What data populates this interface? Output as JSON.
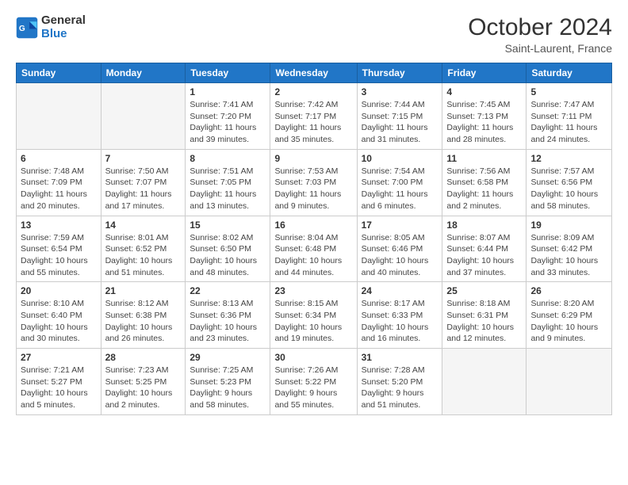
{
  "header": {
    "logo_general": "General",
    "logo_blue": "Blue",
    "month": "October 2024",
    "location": "Saint-Laurent, France"
  },
  "days_of_week": [
    "Sunday",
    "Monday",
    "Tuesday",
    "Wednesday",
    "Thursday",
    "Friday",
    "Saturday"
  ],
  "weeks": [
    [
      {
        "day": "",
        "sunrise": "",
        "sunset": "",
        "daylight": "",
        "empty": true
      },
      {
        "day": "",
        "sunrise": "",
        "sunset": "",
        "daylight": "",
        "empty": true
      },
      {
        "day": "1",
        "sunrise": "Sunrise: 7:41 AM",
        "sunset": "Sunset: 7:20 PM",
        "daylight": "Daylight: 11 hours and 39 minutes."
      },
      {
        "day": "2",
        "sunrise": "Sunrise: 7:42 AM",
        "sunset": "Sunset: 7:17 PM",
        "daylight": "Daylight: 11 hours and 35 minutes."
      },
      {
        "day": "3",
        "sunrise": "Sunrise: 7:44 AM",
        "sunset": "Sunset: 7:15 PM",
        "daylight": "Daylight: 11 hours and 31 minutes."
      },
      {
        "day": "4",
        "sunrise": "Sunrise: 7:45 AM",
        "sunset": "Sunset: 7:13 PM",
        "daylight": "Daylight: 11 hours and 28 minutes."
      },
      {
        "day": "5",
        "sunrise": "Sunrise: 7:47 AM",
        "sunset": "Sunset: 7:11 PM",
        "daylight": "Daylight: 11 hours and 24 minutes."
      }
    ],
    [
      {
        "day": "6",
        "sunrise": "Sunrise: 7:48 AM",
        "sunset": "Sunset: 7:09 PM",
        "daylight": "Daylight: 11 hours and 20 minutes."
      },
      {
        "day": "7",
        "sunrise": "Sunrise: 7:50 AM",
        "sunset": "Sunset: 7:07 PM",
        "daylight": "Daylight: 11 hours and 17 minutes."
      },
      {
        "day": "8",
        "sunrise": "Sunrise: 7:51 AM",
        "sunset": "Sunset: 7:05 PM",
        "daylight": "Daylight: 11 hours and 13 minutes."
      },
      {
        "day": "9",
        "sunrise": "Sunrise: 7:53 AM",
        "sunset": "Sunset: 7:03 PM",
        "daylight": "Daylight: 11 hours and 9 minutes."
      },
      {
        "day": "10",
        "sunrise": "Sunrise: 7:54 AM",
        "sunset": "Sunset: 7:00 PM",
        "daylight": "Daylight: 11 hours and 6 minutes."
      },
      {
        "day": "11",
        "sunrise": "Sunrise: 7:56 AM",
        "sunset": "Sunset: 6:58 PM",
        "daylight": "Daylight: 11 hours and 2 minutes."
      },
      {
        "day": "12",
        "sunrise": "Sunrise: 7:57 AM",
        "sunset": "Sunset: 6:56 PM",
        "daylight": "Daylight: 10 hours and 58 minutes."
      }
    ],
    [
      {
        "day": "13",
        "sunrise": "Sunrise: 7:59 AM",
        "sunset": "Sunset: 6:54 PM",
        "daylight": "Daylight: 10 hours and 55 minutes."
      },
      {
        "day": "14",
        "sunrise": "Sunrise: 8:01 AM",
        "sunset": "Sunset: 6:52 PM",
        "daylight": "Daylight: 10 hours and 51 minutes."
      },
      {
        "day": "15",
        "sunrise": "Sunrise: 8:02 AM",
        "sunset": "Sunset: 6:50 PM",
        "daylight": "Daylight: 10 hours and 48 minutes."
      },
      {
        "day": "16",
        "sunrise": "Sunrise: 8:04 AM",
        "sunset": "Sunset: 6:48 PM",
        "daylight": "Daylight: 10 hours and 44 minutes."
      },
      {
        "day": "17",
        "sunrise": "Sunrise: 8:05 AM",
        "sunset": "Sunset: 6:46 PM",
        "daylight": "Daylight: 10 hours and 40 minutes."
      },
      {
        "day": "18",
        "sunrise": "Sunrise: 8:07 AM",
        "sunset": "Sunset: 6:44 PM",
        "daylight": "Daylight: 10 hours and 37 minutes."
      },
      {
        "day": "19",
        "sunrise": "Sunrise: 8:09 AM",
        "sunset": "Sunset: 6:42 PM",
        "daylight": "Daylight: 10 hours and 33 minutes."
      }
    ],
    [
      {
        "day": "20",
        "sunrise": "Sunrise: 8:10 AM",
        "sunset": "Sunset: 6:40 PM",
        "daylight": "Daylight: 10 hours and 30 minutes."
      },
      {
        "day": "21",
        "sunrise": "Sunrise: 8:12 AM",
        "sunset": "Sunset: 6:38 PM",
        "daylight": "Daylight: 10 hours and 26 minutes."
      },
      {
        "day": "22",
        "sunrise": "Sunrise: 8:13 AM",
        "sunset": "Sunset: 6:36 PM",
        "daylight": "Daylight: 10 hours and 23 minutes."
      },
      {
        "day": "23",
        "sunrise": "Sunrise: 8:15 AM",
        "sunset": "Sunset: 6:34 PM",
        "daylight": "Daylight: 10 hours and 19 minutes."
      },
      {
        "day": "24",
        "sunrise": "Sunrise: 8:17 AM",
        "sunset": "Sunset: 6:33 PM",
        "daylight": "Daylight: 10 hours and 16 minutes."
      },
      {
        "day": "25",
        "sunrise": "Sunrise: 8:18 AM",
        "sunset": "Sunset: 6:31 PM",
        "daylight": "Daylight: 10 hours and 12 minutes."
      },
      {
        "day": "26",
        "sunrise": "Sunrise: 8:20 AM",
        "sunset": "Sunset: 6:29 PM",
        "daylight": "Daylight: 10 hours and 9 minutes."
      }
    ],
    [
      {
        "day": "27",
        "sunrise": "Sunrise: 7:21 AM",
        "sunset": "Sunset: 5:27 PM",
        "daylight": "Daylight: 10 hours and 5 minutes."
      },
      {
        "day": "28",
        "sunrise": "Sunrise: 7:23 AM",
        "sunset": "Sunset: 5:25 PM",
        "daylight": "Daylight: 10 hours and 2 minutes."
      },
      {
        "day": "29",
        "sunrise": "Sunrise: 7:25 AM",
        "sunset": "Sunset: 5:23 PM",
        "daylight": "Daylight: 9 hours and 58 minutes."
      },
      {
        "day": "30",
        "sunrise": "Sunrise: 7:26 AM",
        "sunset": "Sunset: 5:22 PM",
        "daylight": "Daylight: 9 hours and 55 minutes."
      },
      {
        "day": "31",
        "sunrise": "Sunrise: 7:28 AM",
        "sunset": "Sunset: 5:20 PM",
        "daylight": "Daylight: 9 hours and 51 minutes."
      },
      {
        "day": "",
        "sunrise": "",
        "sunset": "",
        "daylight": "",
        "empty": true
      },
      {
        "day": "",
        "sunrise": "",
        "sunset": "",
        "daylight": "",
        "empty": true
      }
    ]
  ]
}
